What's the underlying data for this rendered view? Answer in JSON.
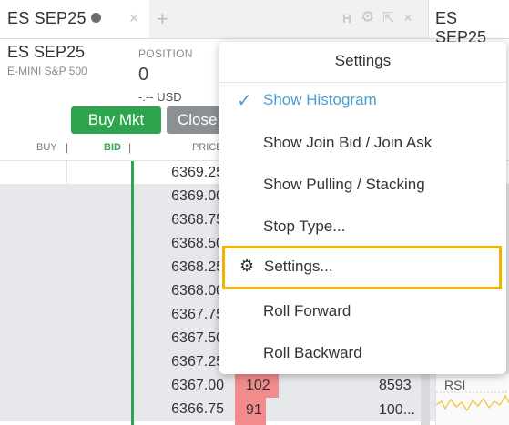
{
  "tabs": {
    "active_title": "ES SEP25",
    "close_glyph": "×",
    "add_glyph": "+",
    "second_title": "ES SEP25"
  },
  "window_controls": {
    "h_label": "H",
    "gear_glyph": "⚙",
    "popout_glyph": "⇱",
    "close_glyph": "×"
  },
  "header": {
    "symbol": "ES SEP25",
    "description": "E-MINI S&P 500",
    "position_label": "POSITION",
    "position_value": "0",
    "pnl_value": "-.-- USD",
    "buy_button": "Buy Mkt",
    "close_button": "Close"
  },
  "columns": {
    "buy": "BUY",
    "sep": "|",
    "bid": "BID",
    "price": "PRICE"
  },
  "ladder": {
    "prices": [
      "6369.25",
      "6369.00",
      "6368.75",
      "6368.50",
      "6368.25",
      "6368.00",
      "6367.75",
      "6367.50",
      "6367.25",
      "6367.00",
      "6366.75"
    ],
    "shaded_rows": [
      1,
      2,
      3,
      4,
      5,
      6,
      7,
      8,
      9,
      10
    ],
    "volumes": {
      "row9": "102",
      "row10": "91"
    },
    "right_values": {
      "row9": "8593",
      "row10": "100..."
    },
    "indicator_label": "RSI"
  },
  "menu": {
    "title": "Settings",
    "items": [
      {
        "label": "Show Histogram",
        "checked": true
      },
      {
        "label": "Show Join Bid / Join Ask",
        "checked": false
      },
      {
        "label": "Show Pulling / Stacking",
        "checked": false
      },
      {
        "label": "Stop Type...",
        "checked": false
      },
      {
        "label": "Settings...",
        "checked": false,
        "icon": "gear-icon"
      },
      {
        "label": "Roll Forward",
        "checked": false
      },
      {
        "label": "Roll Backward",
        "checked": false
      }
    ],
    "check_glyph": "✓",
    "gear_glyph": "⚙"
  },
  "colors": {
    "accent": "#4a9ed3",
    "buy": "#2ea44f",
    "highlight": "#f2b300",
    "volume": "#f28b8b"
  }
}
